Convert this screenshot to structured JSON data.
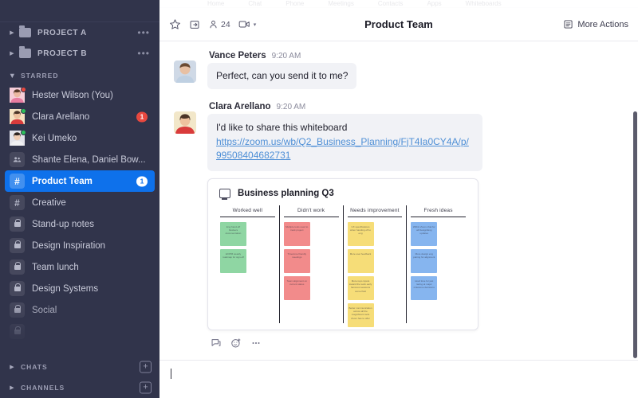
{
  "app": {
    "ghost_tabs": [
      "Home",
      "Chat",
      "Phone",
      "Meetings",
      "Contacts",
      "Apps",
      "Whiteboards"
    ]
  },
  "sidebar": {
    "projects": [
      {
        "label": "PROJECT A",
        "icon": "folder-icon",
        "menu": "•••"
      },
      {
        "label": "PROJECT B",
        "icon": "folder-icon",
        "menu": "•••"
      }
    ],
    "starred_header": "STARRED",
    "items": [
      {
        "label": "Hester Wilson (You)",
        "type": "person",
        "presence": "red",
        "badge": ""
      },
      {
        "label": "Clara Arellano",
        "type": "person",
        "presence": "green",
        "badge": "1"
      },
      {
        "label": "Kei Umeko",
        "type": "person",
        "presence": "green",
        "badge": ""
      },
      {
        "label": "Shante Elena, Daniel Bow...",
        "type": "group",
        "presence": "",
        "badge": ""
      },
      {
        "label": "Product Team",
        "type": "channel",
        "active": true,
        "badge": "1"
      },
      {
        "label": "Creative",
        "type": "channel",
        "badge": ""
      },
      {
        "label": "Stand-up notes",
        "type": "private",
        "badge": ""
      },
      {
        "label": "Design Inspiration",
        "type": "private",
        "badge": ""
      },
      {
        "label": "Team lunch",
        "type": "private",
        "badge": ""
      },
      {
        "label": "Design Systems",
        "type": "private",
        "badge": ""
      },
      {
        "label": "Social",
        "type": "private",
        "badge": ""
      },
      {
        "label": "",
        "type": "private",
        "badge": ""
      }
    ],
    "footer": [
      {
        "label": "CHATS",
        "add": "+"
      },
      {
        "label": "CHANNELS",
        "add": "+"
      }
    ]
  },
  "toolbar": {
    "star_icon": "star-icon",
    "share_icon": "open-in-new-icon",
    "members_icon": "person-icon",
    "members_count": "24",
    "video_icon": "video-camera-icon",
    "chevron": "▾",
    "title": "Product Team",
    "more_actions_icon": "list-icon",
    "more_actions_label": "More Actions"
  },
  "messages": [
    {
      "name": "Vance Peters",
      "time": "9:20 AM",
      "text": "Perfect, can you send it to me?",
      "avatar_bg": "#cfd9e6",
      "avatar_skin": "#e8c0a3",
      "avatar_hair": "#6b4a32",
      "avatar_shirt": "#bfd0e2"
    },
    {
      "name": "Clara Arellano",
      "time": "9:20 AM",
      "text": "I'd like to share this whiteboard",
      "link": "https://zoom.us/wb/Q2_Business_Planning/FjT4Ia0CY4A/p/99508404682731",
      "avatar_bg": "#f2e7c9",
      "avatar_skin": "#eec19e",
      "avatar_hair": "#4b3427",
      "avatar_shirt": "#d93b3b"
    }
  ],
  "whiteboard": {
    "icon": "whiteboard-icon",
    "title": "Business planning Q3",
    "columns": [
      {
        "header": "Worked well",
        "color": "green",
        "notes": [
          "Eng hand-off blockers documentation",
          "EX/PM weekly roadmap for sign-off"
        ]
      },
      {
        "header": "Didn't work",
        "color": "red",
        "notes": [
          "Multiple tools used to track project",
          "Timezone friendly meetings",
          "Team alignment on current status"
        ]
      },
      {
        "header": "Needs improvement",
        "color": "yellow",
        "notes": [
          "UX specifications when handing off to eng",
          "More user feedback",
          "More repo inputs toward the work early hand-out sessions some fluid",
          "Better communication across all the magnificent tools Zoom has to offer"
        ]
      },
      {
        "header": "Fresh ideas",
        "color": "blue",
        "notes": [
          "Within Zoom chat for all Design/Eng updates",
          "More design eng pairing for alignment",
          "Howl time for just racing at major milestone decisions"
        ]
      }
    ]
  },
  "message_actions": {
    "reply_icon": "reply-icon",
    "reaction_icon": "emoji-reaction-icon",
    "more_icon": "more-horizontal-icon"
  },
  "composer": {
    "value": "",
    "placeholder": ""
  }
}
